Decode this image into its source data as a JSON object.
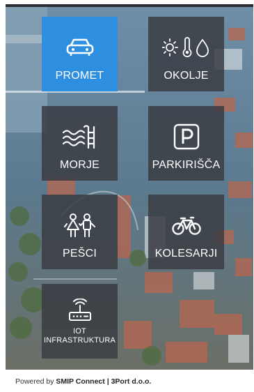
{
  "tiles": [
    {
      "id": "promet",
      "label": "PROMET",
      "icon": "car-icon",
      "active": true
    },
    {
      "id": "okolje",
      "label": "OKOLJE",
      "icon": "weather-sensors-icon",
      "active": false
    },
    {
      "id": "morje",
      "label": "MORJE",
      "icon": "waves-icon",
      "active": false
    },
    {
      "id": "parkirisca",
      "label": "PARKIRIŠČA",
      "icon": "parking-icon",
      "active": false
    },
    {
      "id": "pesci",
      "label": "PEŠCI",
      "icon": "pedestrians-icon",
      "active": false
    },
    {
      "id": "kolesarji",
      "label": "KOLESARJI",
      "icon": "bicycle-icon",
      "active": false
    },
    {
      "id": "iot",
      "label_line1": "IOT",
      "label_line2": "INFRASTRUKTURA",
      "icon": "router-icon",
      "active": false
    }
  ],
  "footer": {
    "prefix": "Powered by ",
    "brand": "SMIP Connect",
    "separator": " | ",
    "company": "3Port d.o.o."
  },
  "colors": {
    "accent": "#2e8fe0",
    "tile": "#3a3c42"
  }
}
